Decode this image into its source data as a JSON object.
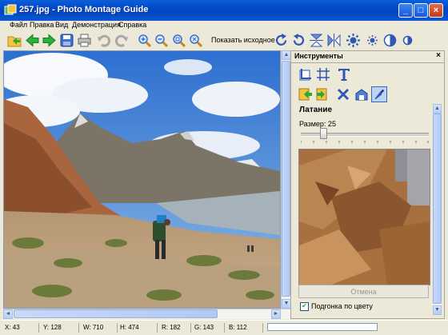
{
  "window": {
    "title": "257.jpg - Photo Montage Guide",
    "icon": "app-icon",
    "buttons": [
      "minimize",
      "maximize",
      "close"
    ]
  },
  "menu": {
    "items": [
      "Файл",
      "Правка",
      "Вид",
      "Демонстрация",
      "Справка"
    ]
  },
  "toolbar": {
    "show_original_label": "Показать исходное",
    "icons": [
      "open-icon",
      "back-arrow-icon",
      "forward-arrow-icon",
      "save-icon",
      "print-icon",
      "undo-icon",
      "redo-icon",
      "zoom-in-icon",
      "zoom-out-icon",
      "zoom-fit-icon",
      "actual-size-icon",
      "rotate-right-icon",
      "rotate-left-icon",
      "flip-vertical-icon",
      "flip-horizontal-icon",
      "brightness-icon",
      "sharpen-icon",
      "contrast-icon",
      "color-balance-icon"
    ]
  },
  "panel": {
    "title": "Инструменты",
    "close_label": "×",
    "section_title": "Латание",
    "size_label": "Размер: 25",
    "size_value": 25,
    "cancel_label": "Отмена",
    "checkbox_label": "Подгонка по цвету",
    "checkbox_checked": true,
    "tools": [
      "crop-icon",
      "grid-icon",
      "text-icon",
      "patch-icon",
      "clone-icon",
      "remove-icon",
      "hat-icon",
      "brush-icon"
    ]
  },
  "status": {
    "x": "X: 43",
    "y": "Y: 128",
    "w": "W: 710",
    "h": "H: 474",
    "r": "R: 182",
    "g": "G: 143",
    "b": "B: 112"
  },
  "colors": {
    "title_bar": "#0347c9",
    "accent": "#316ac5"
  }
}
